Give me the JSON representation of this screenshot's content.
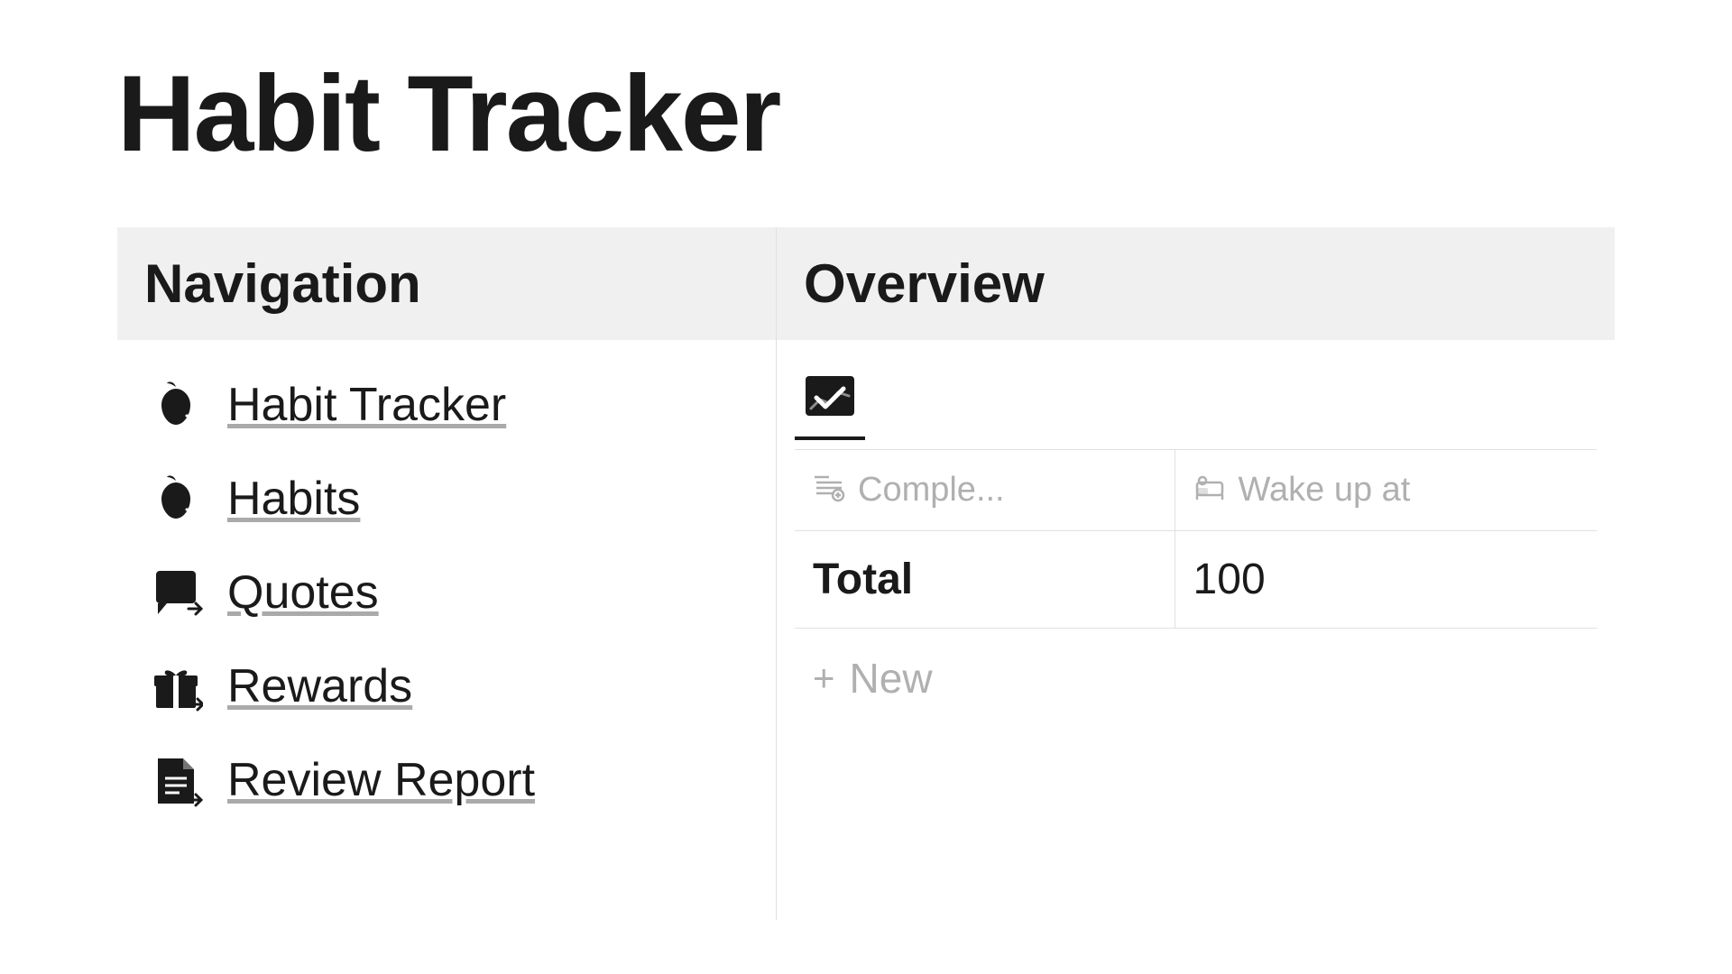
{
  "app": {
    "title": "Habit Tracker"
  },
  "navigation": {
    "header": "Navigation",
    "items": [
      {
        "id": "habit-tracker",
        "label": "Habit Tracker",
        "icon": "🍎",
        "icon_name": "habit-tracker-icon"
      },
      {
        "id": "habits",
        "label": "Habits",
        "icon": "🍎",
        "icon_name": "habits-icon"
      },
      {
        "id": "quotes",
        "label": "Quotes",
        "icon": "💬",
        "icon_name": "quotes-icon"
      },
      {
        "id": "rewards",
        "label": "Rewards",
        "icon": "🎁",
        "icon_name": "rewards-icon"
      },
      {
        "id": "review-report",
        "label": "Review Report",
        "icon": "📄",
        "icon_name": "review-report-icon"
      }
    ]
  },
  "overview": {
    "header": "Overview",
    "tab_icon": "📊",
    "columns": [
      {
        "id": "complete",
        "label": "Comple...",
        "icon": "⚙️",
        "icon_name": "complete-col-icon"
      },
      {
        "id": "wake-up",
        "label": "Wake up at",
        "icon": "🛏️",
        "icon_name": "wakeup-col-icon"
      }
    ],
    "rows": [
      {
        "label": "Total",
        "values": [
          "100"
        ]
      }
    ],
    "new_label": "New",
    "new_icon": "+"
  }
}
